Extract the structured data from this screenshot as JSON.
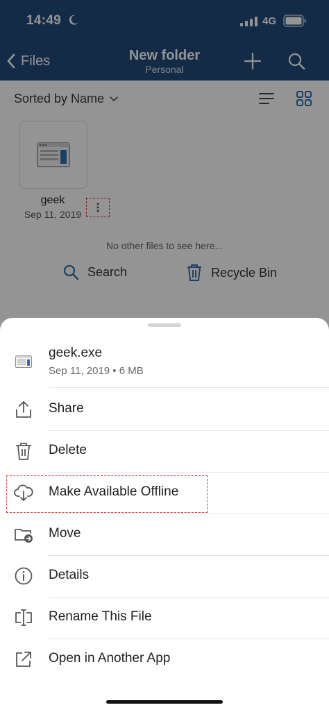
{
  "status_bar": {
    "time": "14:49",
    "network": "4G"
  },
  "nav": {
    "back_label": "Files",
    "title": "New folder",
    "subtitle": "Personal"
  },
  "toolbar": {
    "sort_label": "Sorted by Name"
  },
  "file": {
    "name": "geek",
    "date": "Sep 11, 2019"
  },
  "empty_message": "No other files to see here...",
  "quick_actions": {
    "search_label": "Search",
    "recycle_label": "Recycle Bin"
  },
  "sheet": {
    "file_name": "geek.exe",
    "file_meta": "Sep 11, 2019 • 6 MB",
    "actions": [
      {
        "label": "Share",
        "icon": "share-icon"
      },
      {
        "label": "Delete",
        "icon": "trash-icon"
      },
      {
        "label": "Make Available Offline",
        "icon": "cloud-download-icon"
      },
      {
        "label": "Move",
        "icon": "folder-move-icon"
      },
      {
        "label": "Details",
        "icon": "info-icon"
      },
      {
        "label": "Rename This File",
        "icon": "rename-icon"
      },
      {
        "label": "Open in Another App",
        "icon": "external-link-icon"
      }
    ]
  },
  "colors": {
    "brand": "#244a7d",
    "accent": "#2f6fb3",
    "highlight": "#e03a3a"
  }
}
